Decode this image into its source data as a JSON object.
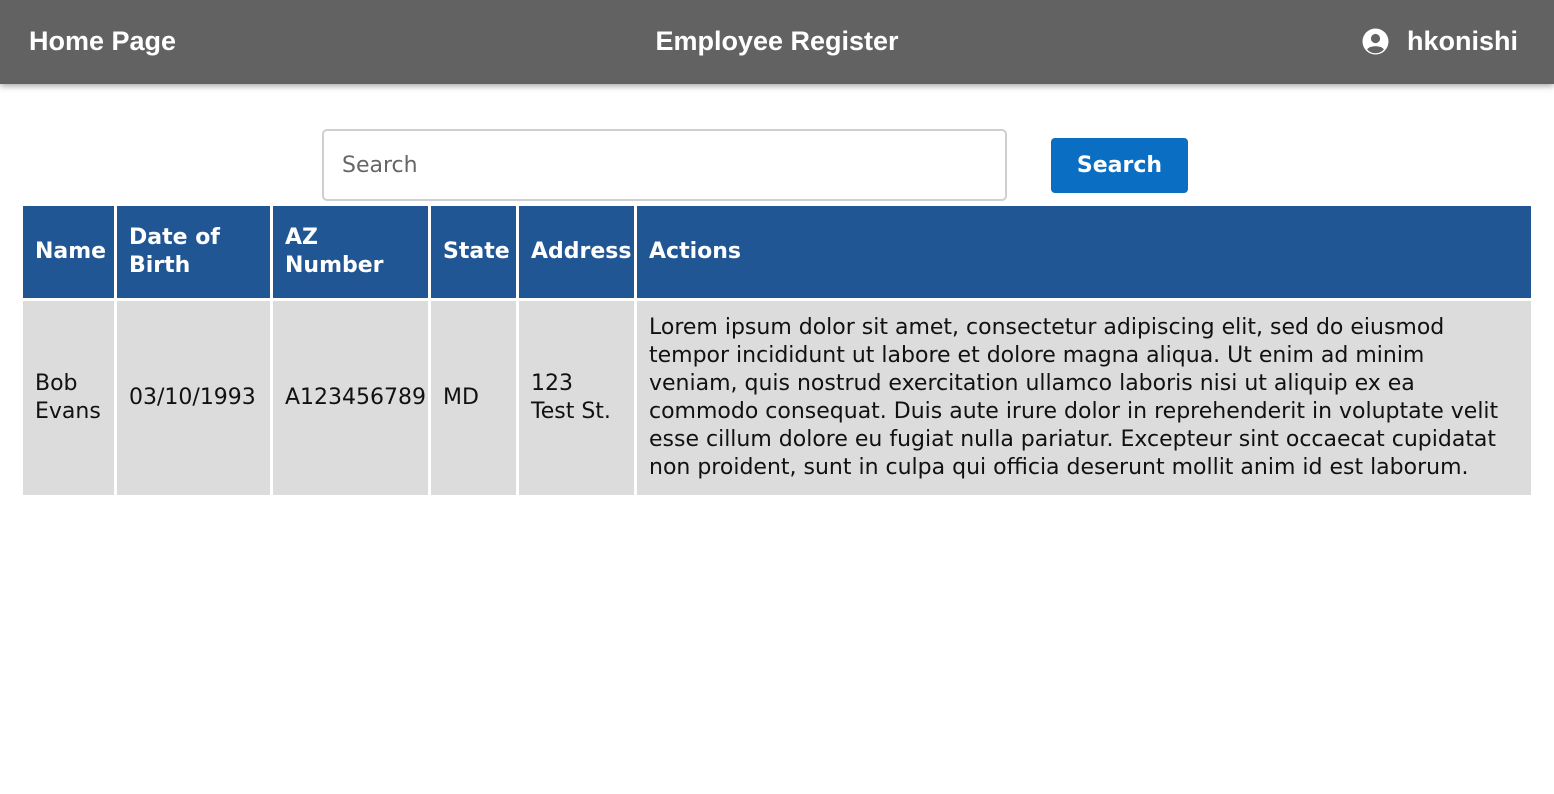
{
  "header": {
    "home_label": "Home Page",
    "title": "Employee Register",
    "username": "hkonishi",
    "user_icon": "user-circle-icon"
  },
  "search": {
    "placeholder": "Search",
    "value": "",
    "button_label": "Search"
  },
  "table": {
    "columns": [
      "Name",
      "Date of Birth",
      "AZ Number",
      "State",
      "Address",
      "Actions"
    ],
    "rows": [
      {
        "name": "Bob Evans",
        "date_of_birth": "03/10/1993",
        "az_number": "A123456789",
        "state": "MD",
        "address": "123 Test St.",
        "actions": "Lorem ipsum dolor sit amet, consectetur adipiscing elit, sed do eiusmod tempor incididunt ut labore et dolore magna aliqua. Ut enim ad minim veniam, quis nostrud exercitation ullamco laboris nisi ut aliquip ex ea commodo consequat. Duis aute irure dolor in reprehenderit in voluptate velit esse cillum dolore eu fugiat nulla pariatur. Excepteur sint occaecat cupidatat non proident, sunt in culpa qui officia deserunt mollit anim id est laborum."
      }
    ]
  },
  "colors": {
    "topbar": "#626262",
    "table_header": "#215694",
    "table_cell": "#dcdcdc",
    "button": "#0a6fc2"
  }
}
